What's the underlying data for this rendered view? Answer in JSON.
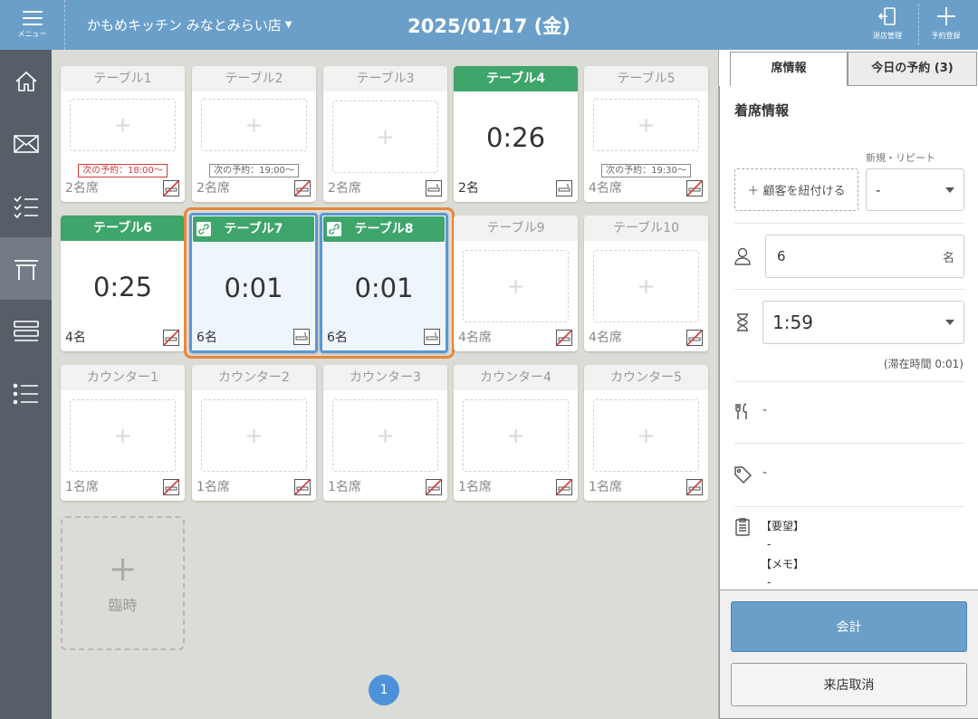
{
  "header": {
    "menu_label": "メニュー",
    "store_name": "かもめキッチン みなとみらい店",
    "date": "2025/01/17 (金)",
    "closing_label": "退店管理",
    "reserve_label": "予約登録"
  },
  "nav": [
    "home-icon",
    "mail-icon",
    "checklist-icon",
    "table-icon",
    "layout-icon",
    "list-icon"
  ],
  "tables": {
    "t1": {
      "name": "テーブル1",
      "next": "次の予約：18:00〜",
      "seats": "2名席"
    },
    "t2": {
      "name": "テーブル2",
      "next": "次の予約：19:00〜",
      "seats": "2名席"
    },
    "t3": {
      "name": "テーブル3",
      "seats": "2名席"
    },
    "t4": {
      "name": "テーブル4",
      "time": "0:26",
      "seats": "2名"
    },
    "t5": {
      "name": "テーブル5",
      "next": "次の予約：19:30〜",
      "seats": "4名席"
    },
    "t6": {
      "name": "テーブル6",
      "time": "0:25",
      "seats": "4名"
    },
    "t7": {
      "name": "テーブル7",
      "time": "0:01",
      "seats": "6名"
    },
    "t8": {
      "name": "テーブル8",
      "time": "0:01",
      "seats": "6名"
    },
    "t9": {
      "name": "テーブル9",
      "seats": "4名席"
    },
    "t10": {
      "name": "テーブル10",
      "seats": "4名席"
    },
    "c1": {
      "name": "カウンター1",
      "seats": "1名席"
    },
    "c2": {
      "name": "カウンター2",
      "seats": "1名席"
    },
    "c3": {
      "name": "カウンター3",
      "seats": "1名席"
    },
    "c4": {
      "name": "カウンター4",
      "seats": "1名席"
    },
    "c5": {
      "name": "カウンター5",
      "seats": "1名席"
    }
  },
  "temp": {
    "plus": "+",
    "label": "臨時"
  },
  "page": "1",
  "panel": {
    "tab_seat": "席情報",
    "tab_reservations": "今日の予約 (3)",
    "section_title": "着席情報",
    "repeat_label": "新規・リピート",
    "link_customer": "＋ 顧客を紐付ける",
    "repeat_value": "-",
    "people_value": "6",
    "people_unit": "名",
    "duration_value": "1:59",
    "stay_time": "(滞在時間 0:01)",
    "course_value": "-",
    "tag_value": "-",
    "request_label": "【要望】",
    "request_value": "-",
    "memo_label": "【メモ】",
    "memo_value": "-",
    "pay_button": "会計",
    "cancel_button": "来店取消"
  }
}
